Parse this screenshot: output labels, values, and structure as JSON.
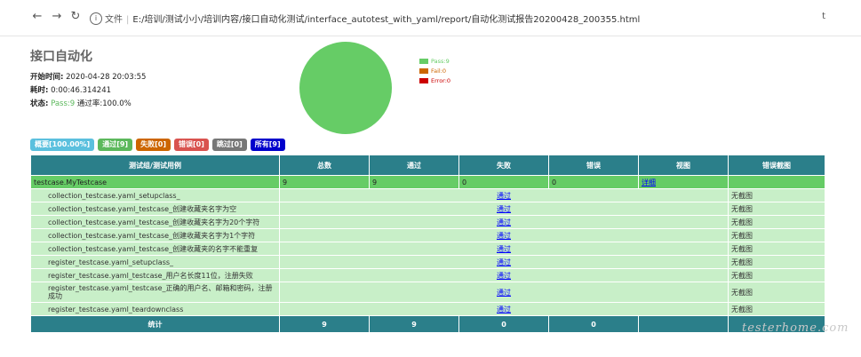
{
  "browser": {
    "url_label": "文件",
    "url": "E:/培训/测试小小/培训内容/接口自动化测试/interface_autotest_with_yaml/report/自动化测试报告20200428_200355.html",
    "right_text": "t"
  },
  "report": {
    "title": "接口自动化",
    "start_label": "开始时间:",
    "start_value": "2020-04-28 20:03:55",
    "duration_label": "耗时:",
    "duration_value": "0:00:46.314241",
    "status_label": "状态:",
    "status_pass": "Pass:9",
    "status_rate": "通过率:100.0%"
  },
  "pie_chart": {
    "legend": [
      {
        "label": "Pass:9",
        "color": "#66cc66"
      },
      {
        "label": "Fail:0",
        "color": "#cc6600"
      },
      {
        "label": "Error:0",
        "color": "#cc0000"
      }
    ]
  },
  "filters": [
    {
      "label": "概要[100.00%]",
      "color": "#5bc0de"
    },
    {
      "label": "通过[9]",
      "color": "#5cb85c"
    },
    {
      "label": "失败[0]",
      "color": "#d9534f"
    },
    {
      "label": "错误[0]",
      "color": "#d9534f"
    },
    {
      "label": "跳过[0]",
      "color": "#777777"
    },
    {
      "label": "所有[9]",
      "color": "#0000cc"
    }
  ],
  "table": {
    "headers": [
      "测试组/测试用例",
      "总数",
      "通过",
      "失败",
      "错误",
      "视图",
      "错误截图"
    ],
    "class_row": {
      "name": "testcase.MyTestcase",
      "total": "9",
      "pass": "9",
      "fail": "0",
      "error": "0",
      "view": "详细",
      "screenshot": ""
    },
    "cases": [
      {
        "name": "collection_testcase.yaml_setupclass_",
        "result": "通过",
        "screenshot": "无截图"
      },
      {
        "name": "collection_testcase.yaml_testcase_创建收藏夹名字为空",
        "result": "通过",
        "screenshot": "无截图"
      },
      {
        "name": "collection_testcase.yaml_testcase_创建收藏夹名字为20个字符",
        "result": "通过",
        "screenshot": "无截图"
      },
      {
        "name": "collection_testcase.yaml_testcase_创建收藏夹名字为1个字符",
        "result": "通过",
        "screenshot": "无截图"
      },
      {
        "name": "collection_testcase.yaml_testcase_创建收藏夹的名字不能重复",
        "result": "通过",
        "screenshot": "无截图"
      },
      {
        "name": "register_testcase.yaml_setupclass_",
        "result": "通过",
        "screenshot": "无截图"
      },
      {
        "name": "register_testcase.yaml_testcase_用户名长度11位，注册失败",
        "result": "通过",
        "screenshot": "无截图"
      },
      {
        "name": "register_testcase.yaml_testcase_正确的用户名、邮箱和密码，注册成功",
        "result": "通过",
        "screenshot": "无截图"
      },
      {
        "name": "register_testcase.yaml_teardownclass",
        "result": "通过",
        "screenshot": "无截图"
      }
    ],
    "total_row": {
      "label": "统计",
      "total": "9",
      "pass": "9",
      "fail": "0",
      "error": "0"
    }
  },
  "watermark": "testerhome.com"
}
